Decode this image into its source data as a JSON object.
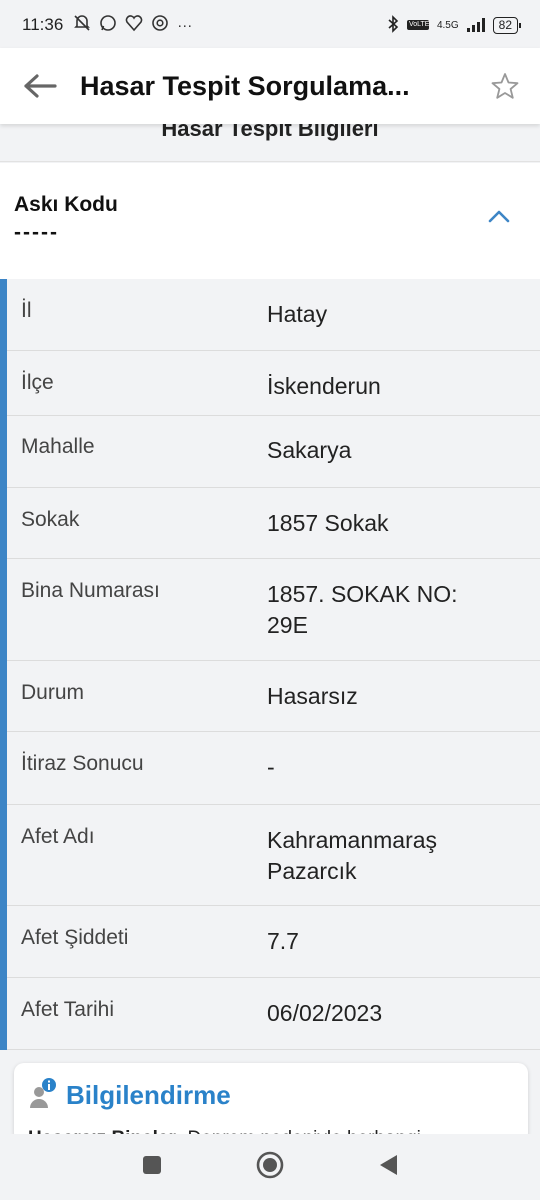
{
  "status_bar": {
    "time": "11:36",
    "network": "4.5G",
    "battery": "82",
    "icons": [
      "mute-icon",
      "whatsapp-icon",
      "health-icon",
      "chrome-icon",
      "more-dots-icon",
      "bluetooth-icon",
      "volte-icon",
      "signal-icon",
      "battery-icon"
    ],
    "more": "···",
    "volte": "VoLTE"
  },
  "app_bar": {
    "title": "Hasar Tespit Sorgulama...",
    "back_icon": "arrow-left-icon",
    "star_icon": "star-outline-icon"
  },
  "section_title": "Hasar Tespit Bilgileri",
  "aski": {
    "label": "Askı Kodu",
    "value": "-----",
    "toggle_icon": "chevron-up-icon"
  },
  "rows": [
    {
      "key": "İl",
      "value": "Hatay"
    },
    {
      "key": "İlçe",
      "value": "İskenderun"
    },
    {
      "key": "Mahalle",
      "value": "Sakarya"
    },
    {
      "key": "Sokak",
      "value": "1857 Sokak"
    },
    {
      "key": "Bina Numarası",
      "value": "1857. SOKAK NO: 29E"
    },
    {
      "key": "Durum",
      "value": "Hasarsız"
    },
    {
      "key": "İtiraz Sonucu",
      "value": "-"
    },
    {
      "key": "Afet Adı",
      "value": "Kahramanmaraş Pazarcık"
    },
    {
      "key": "Afet Şiddeti",
      "value": "7.7"
    },
    {
      "key": "Afet Tarihi",
      "value": "06/02/2023"
    }
  ],
  "info": {
    "title": "Bilgilendirme",
    "icon": "user-info-icon",
    "text_bold": "Hasarsız Binalar:",
    "text": " Deprem nedeniyle herhangi"
  },
  "colors": {
    "accent": "#3d85c6",
    "info_title": "#2a82c9",
    "background": "#f2f3f5"
  },
  "nav": {
    "recents_icon": "square-icon",
    "home_icon": "circle-home-icon",
    "back_icon": "triangle-back-icon"
  }
}
